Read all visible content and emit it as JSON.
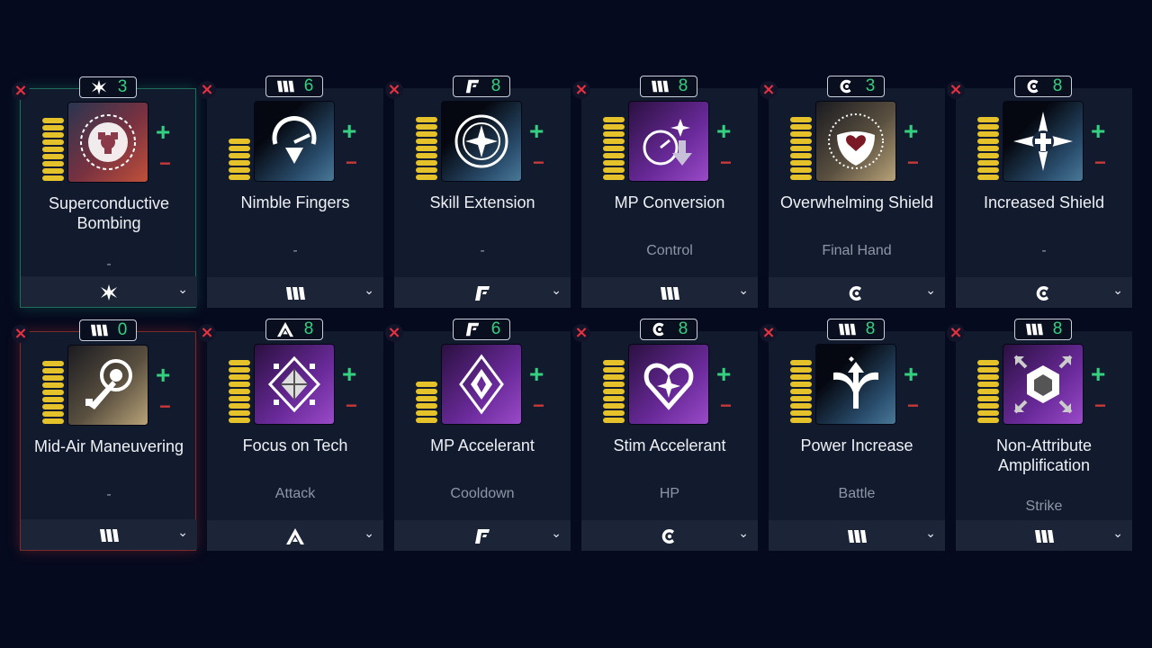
{
  "cards": [
    {
      "name": "Superconductive Bombing",
      "cat": "-",
      "count": "3",
      "type": "shuriken",
      "bars": 9,
      "icon": "reactor-icon",
      "bg": "bg-red",
      "sel": "green"
    },
    {
      "name": "Nimble Fingers",
      "cat": "-",
      "count": "6",
      "type": "stripes",
      "bars": 6,
      "icon": "dial-arrow-icon",
      "bg": "bg-blue",
      "sel": ""
    },
    {
      "name": "Skill Extension",
      "cat": "-",
      "count": "8",
      "type": "bracket",
      "bars": 9,
      "icon": "star-circle-icon",
      "bg": "bg-blue",
      "sel": ""
    },
    {
      "name": "MP Conversion",
      "cat": "Control",
      "count": "8",
      "type": "stripes",
      "bars": 9,
      "icon": "gauge-down-icon",
      "bg": "bg-purple",
      "sel": ""
    },
    {
      "name": "Overwhelming Shield",
      "cat": "Final Hand",
      "count": "3",
      "type": "crescent",
      "bars": 9,
      "icon": "heart-shield-icon",
      "bg": "bg-gold",
      "sel": ""
    },
    {
      "name": "Increased Shield",
      "cat": "-",
      "count": "8",
      "type": "crescent",
      "bars": 9,
      "icon": "cross-star-icon",
      "bg": "bg-blue",
      "sel": ""
    },
    {
      "name": "Mid-Air Maneuvering",
      "cat": "-",
      "count": "0",
      "type": "stripes",
      "bars": 9,
      "icon": "grapple-icon",
      "bg": "bg-gold",
      "sel": "red"
    },
    {
      "name": "Focus on Tech",
      "cat": "Attack",
      "count": "8",
      "type": "chevron",
      "bars": 9,
      "icon": "prism-icon",
      "bg": "bg-purple",
      "sel": ""
    },
    {
      "name": "MP Accelerant",
      "cat": "Cooldown",
      "count": "6",
      "type": "bracket",
      "bars": 6,
      "icon": "diamond-icon",
      "bg": "bg-purple",
      "sel": ""
    },
    {
      "name": "Stim Accelerant",
      "cat": "HP",
      "count": "8",
      "type": "crescent",
      "bars": 9,
      "icon": "heart-spark-icon",
      "bg": "bg-purple",
      "sel": ""
    },
    {
      "name": "Power Increase",
      "cat": "Battle",
      "count": "8",
      "type": "stripes",
      "bars": 9,
      "icon": "arrows-up-icon",
      "bg": "bg-blue",
      "sel": ""
    },
    {
      "name": "Non-Attribute Amplification",
      "cat": "Strike",
      "count": "8",
      "type": "stripes",
      "bars": 9,
      "icon": "hex-burst-icon",
      "bg": "bg-purple",
      "sel": ""
    }
  ],
  "labels": {
    "plus": "+",
    "minus": "−",
    "remove": "×",
    "dropdown": "⌄"
  },
  "colors": {
    "accent_green": "#35d07f",
    "remove_red": "#e8313f",
    "bar_yellow": "#e5c12a"
  }
}
